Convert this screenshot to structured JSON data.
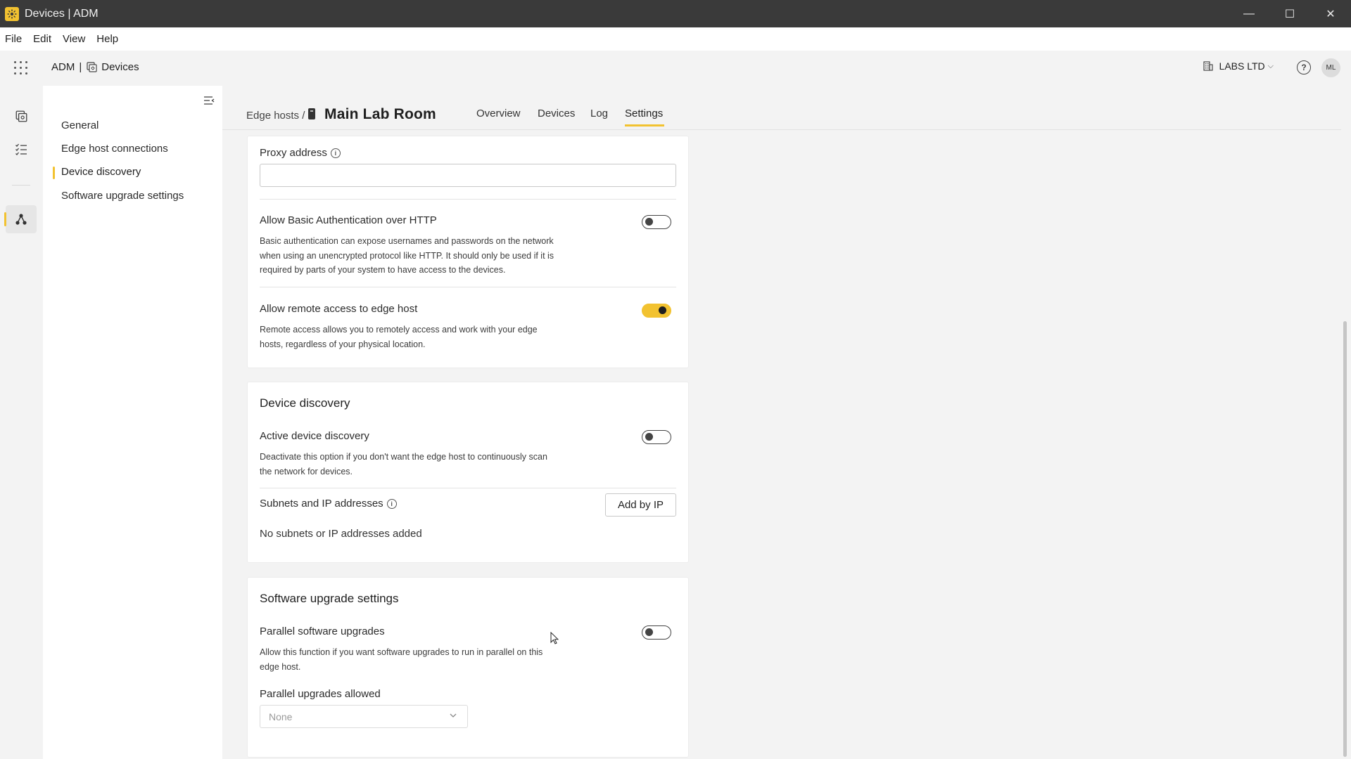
{
  "window": {
    "title": "Devices | ADM",
    "controls": {
      "minimize": "—",
      "maximize": "☐",
      "close": "✕"
    }
  },
  "menubar": {
    "items": [
      "File",
      "Edit",
      "View",
      "Help"
    ]
  },
  "appheader": {
    "brand": "ADM",
    "separator": "|",
    "section": "Devices",
    "org": "LABS LTD",
    "help": "?",
    "avatar": "ML"
  },
  "nav": {
    "items": [
      {
        "label": "General"
      },
      {
        "label": "Edge host connections"
      },
      {
        "label": "Device discovery",
        "active": true
      },
      {
        "label": "Software upgrade settings"
      }
    ]
  },
  "page": {
    "breadcrumb": "Edge hosts /",
    "title": "Main Lab Room",
    "tabs": [
      {
        "label": "Overview"
      },
      {
        "label": "Devices"
      },
      {
        "label": "Log"
      },
      {
        "label": "Settings",
        "active": true
      }
    ]
  },
  "connection": {
    "proxy_label": "Proxy address",
    "proxy_value": "",
    "basic_auth_label": "Allow Basic Authentication over HTTP",
    "basic_auth_desc": "Basic authentication can expose usernames and passwords on the network when using an unencrypted protocol like HTTP. It should only be used if it is required by parts of your system to have access to the devices.",
    "basic_auth_enabled": false,
    "remote_label": "Allow remote access to edge host",
    "remote_desc": "Remote access allows you to remotely access and work with your edge hosts, regardless of your physical location.",
    "remote_enabled": true
  },
  "discovery": {
    "title": "Device discovery",
    "active_label": "Active device discovery",
    "active_desc": "Deactivate this option if you don't want the edge host to continuously scan the network for devices.",
    "active_enabled": false,
    "subnets_label": "Subnets and IP addresses",
    "add_button": "Add by IP",
    "empty_text": "No subnets or IP addresses added"
  },
  "upgrade": {
    "title": "Software upgrade settings",
    "parallel_label": "Parallel software upgrades",
    "parallel_desc": "Allow this function if you want software upgrades to run in parallel on this edge host.",
    "parallel_enabled": false,
    "allowed_label": "Parallel upgrades allowed",
    "allowed_value": "None"
  },
  "colors": {
    "accent": "#f2c230",
    "titlebar": "#3a3a3a",
    "background": "#f3f3f3"
  }
}
